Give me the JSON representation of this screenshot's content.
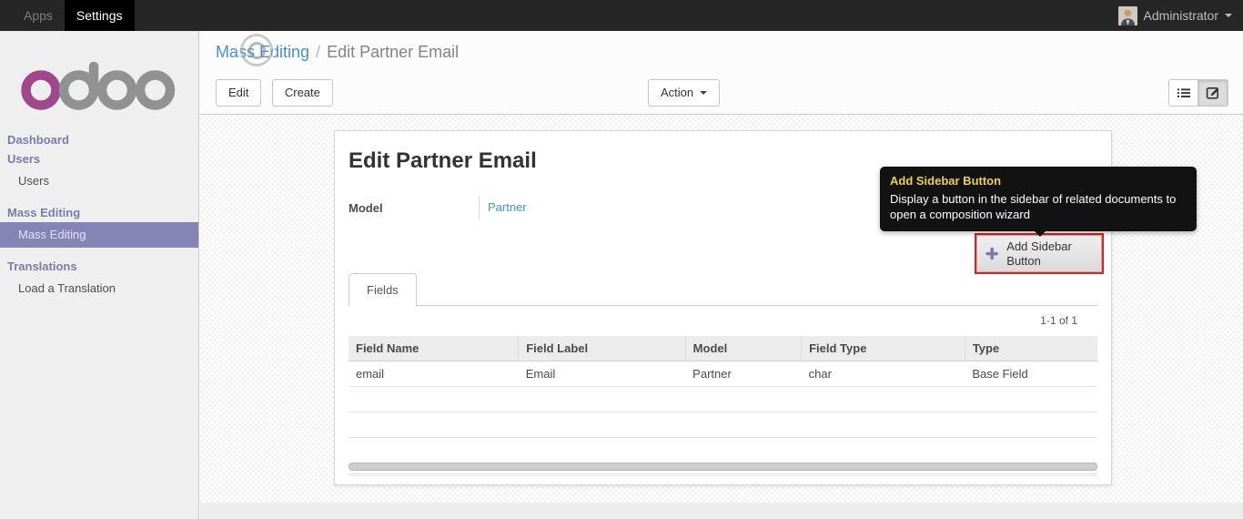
{
  "topbar": {
    "menus": [
      {
        "label": "Apps",
        "active": false
      },
      {
        "label": "Settings",
        "active": true
      }
    ],
    "user": {
      "name": "Administrator"
    }
  },
  "sidebar": {
    "logo_text": "odoo",
    "sections": [
      {
        "heading": "Dashboard",
        "items": []
      },
      {
        "heading": "Users",
        "items": [
          {
            "label": "Users",
            "active": false
          }
        ]
      },
      {
        "heading": "Mass Editing",
        "items": [
          {
            "label": "Mass Editing",
            "active": true
          }
        ]
      },
      {
        "heading": "Translations",
        "items": [
          {
            "label": "Load a Translation",
            "active": false
          }
        ]
      }
    ]
  },
  "breadcrumb": {
    "parent": "Mass Editing",
    "separator": "/",
    "current": "Edit Partner Email"
  },
  "control_panel": {
    "edit_label": "Edit",
    "create_label": "Create",
    "action_label": "Action"
  },
  "form": {
    "title": "Edit Partner Email",
    "model_label": "Model",
    "model_value": "Partner",
    "add_sidebar_button_label": "Add Sidebar Button",
    "tab_fields_label": "Fields",
    "pager": "1-1 of 1"
  },
  "tooltip": {
    "title": "Add Sidebar Button",
    "body": "Display a button in the sidebar of related documents to open a composition wizard"
  },
  "table": {
    "headers": [
      "Field Name",
      "Field Label",
      "Model",
      "Field Type",
      "Type"
    ],
    "rows": [
      [
        "email",
        "Email",
        "Partner",
        "char",
        "Base Field"
      ]
    ]
  },
  "icons": {
    "avatar": "user-photo",
    "user_caret": "caret-down",
    "action_caret": "caret-down",
    "view_list": "list-bullets",
    "view_form": "pencil-square",
    "add_plus": "plus",
    "spinner": "loading-rings"
  },
  "colors": {
    "topbar_bg": "#262626",
    "topbar_active_bg": "#000000",
    "sidebar_heading": "#7b7aad",
    "sidebar_active_bg": "#8584b7",
    "link_blue": "#4592c8",
    "logo_magenta": "#a0488c",
    "logo_gray": "#919191",
    "tooltip_title_yellow": "#edd052",
    "annotation_red": "#e0201d",
    "plus_purple": "#7b7aad"
  }
}
